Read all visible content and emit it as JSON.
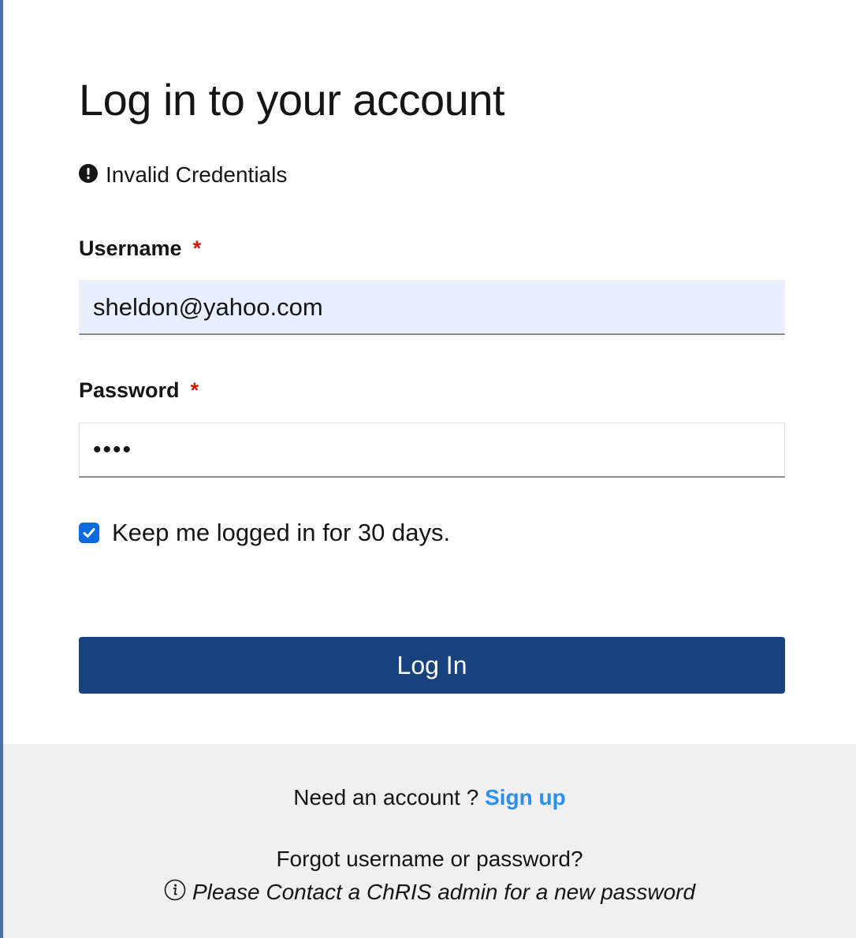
{
  "login": {
    "title": "Log in to your account",
    "error_message": "Invalid Credentials",
    "error_icon": "exclamation-circle-icon",
    "username": {
      "label": "Username",
      "required_marker": "*",
      "value": "sheldon@yahoo.com"
    },
    "password": {
      "label": "Password",
      "required_marker": "*",
      "masked_value": "••••"
    },
    "remember": {
      "label": "Keep me logged in for 30 days.",
      "checked": true
    },
    "submit_label": "Log In"
  },
  "footer": {
    "need_account_text": "Need an account ?",
    "signup_label": "Sign up",
    "forgot_text": "Forgot username or password?",
    "contact_icon": "info-circle-icon",
    "contact_text": "Please Contact a ChRIS admin for a new password"
  },
  "colors": {
    "primary_button": "#17427b",
    "link": "#2b8ff0",
    "required": "#c9190b",
    "autofill_bg": "#e8f0fe",
    "checkbox": "#0b6bdc",
    "footer_bg": "#f0f0f0"
  }
}
